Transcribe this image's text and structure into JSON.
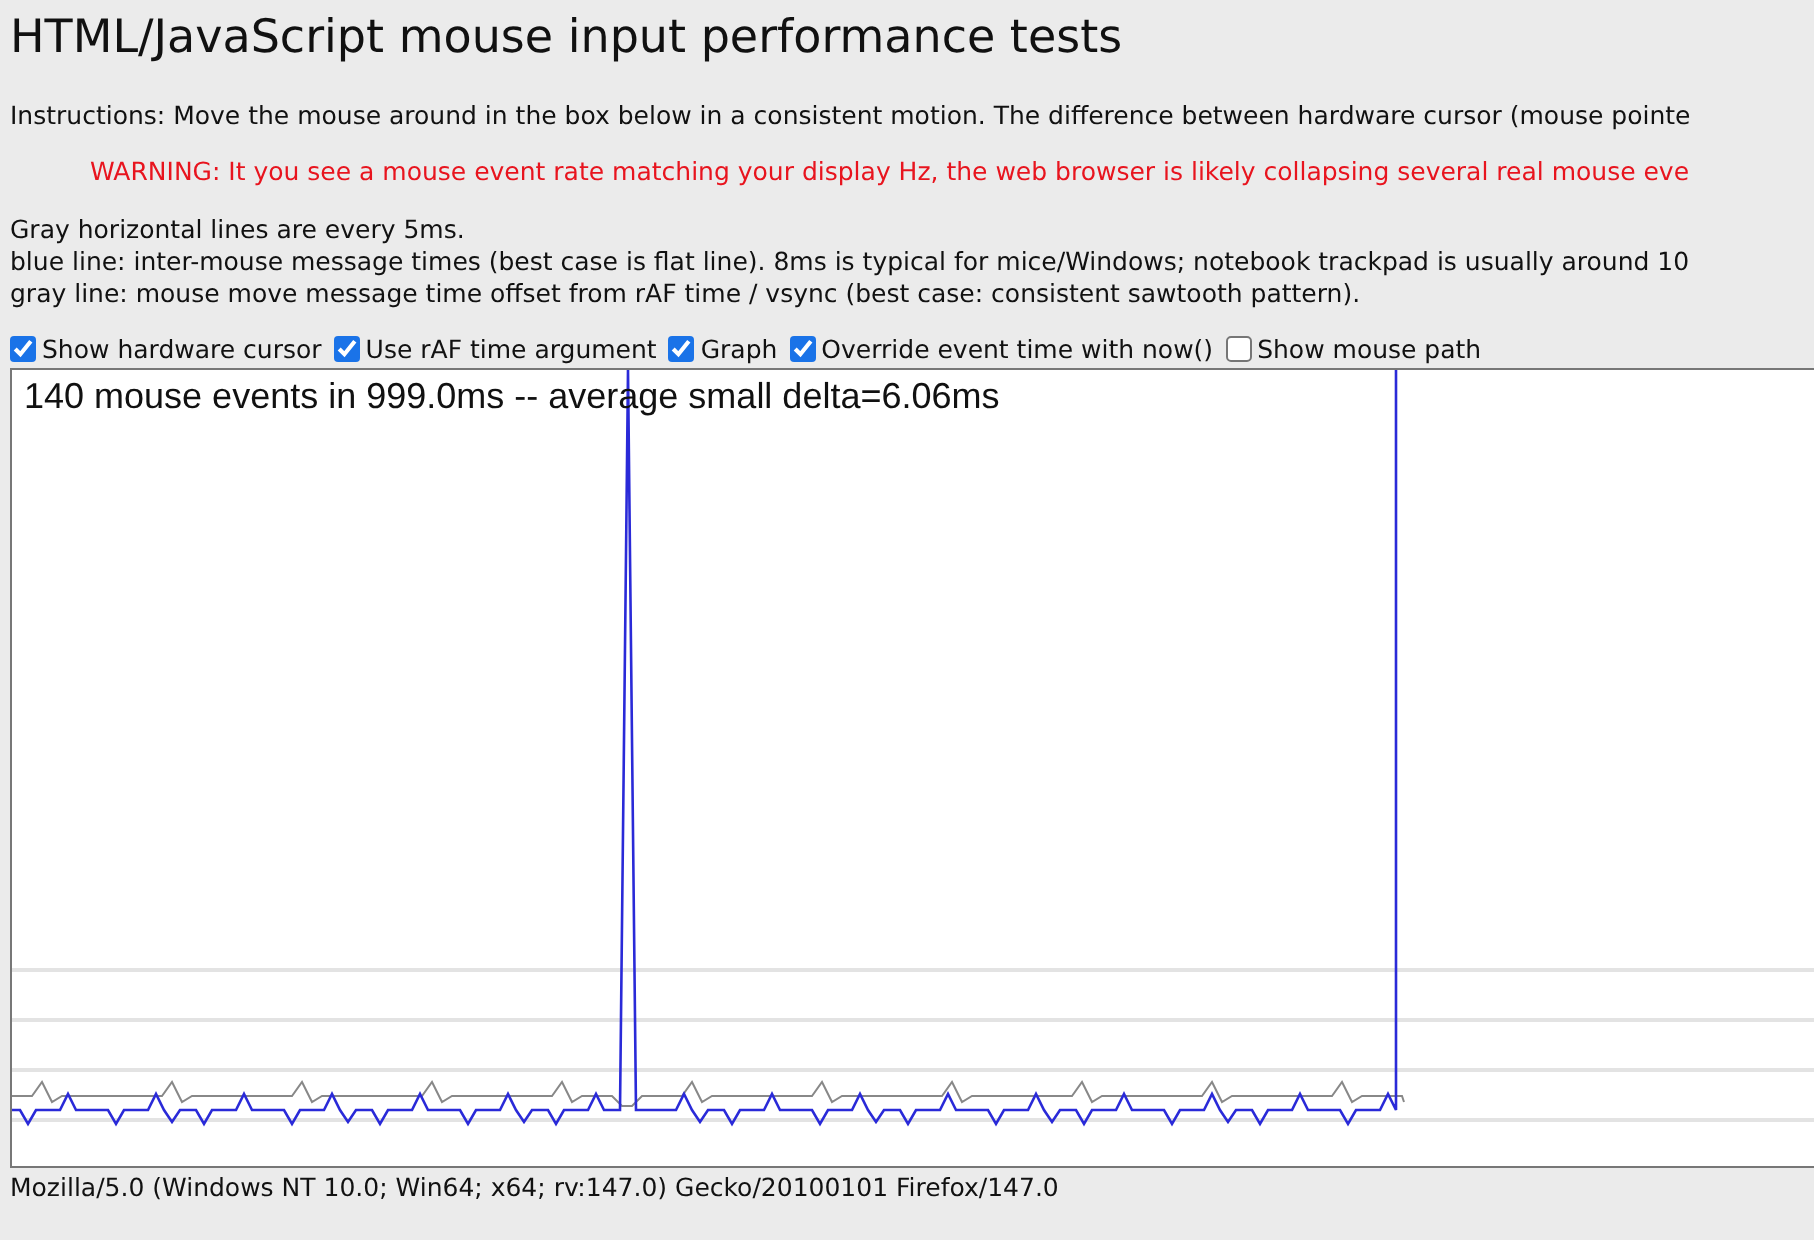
{
  "title": "HTML/JavaScript mouse input performance tests",
  "instructions": "Instructions: Move the mouse around in the box below in a consistent motion. The difference between hardware cursor (mouse pointe",
  "warning": "WARNING: It you see a mouse event rate matching your display Hz, the web browser is likely collapsing several real mouse eve",
  "notes": [
    "Gray horizontal lines are every 5ms.",
    "blue line: inter-mouse message times (best case is flat line). 8ms is typical for mice/Windows; notebook trackpad is usually around 10",
    "gray line: mouse move message time offset from rAF time / vsync (best case: consistent sawtooth pattern)."
  ],
  "options": [
    {
      "label": "Show hardware cursor",
      "checked": true
    },
    {
      "label": "Use rAF time argument",
      "checked": true
    },
    {
      "label": "Graph",
      "checked": true
    },
    {
      "label": "Override event time with now()",
      "checked": true
    },
    {
      "label": "Show mouse path",
      "checked": false
    }
  ],
  "graph": {
    "summary": "140 mouse events in 999.0ms -- average small delta=6.06ms"
  },
  "user_agent": "Mozilla/5.0 (Windows NT 10.0; Win64; x64; rv:147.0) Gecko/20100101 Firefox/147.0"
}
